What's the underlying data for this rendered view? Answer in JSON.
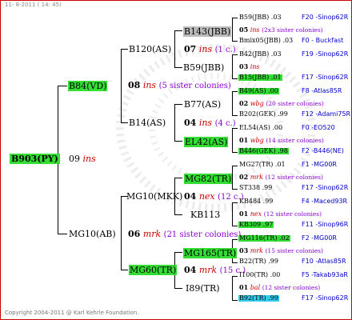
{
  "header": {
    "date": "11- 8-2011 ( 14: 45)"
  },
  "footer": {
    "copyright": "Copyright 2004-2011 @ Karl Kehrle Foundation."
  },
  "root": {
    "label": "B903(PY)",
    "year": "09",
    "mark": "ins"
  },
  "gen1": [
    {
      "label": "B84(VD)",
      "year": "08",
      "mark": "ins",
      "note": "(5 sister colonies)"
    },
    {
      "label": "MG10(AB)",
      "year": "06",
      "mark": "mrk",
      "note": "(21 sister colonies)"
    }
  ],
  "gen2": [
    {
      "label": "B120(AS)",
      "year": "07",
      "mark": "ins",
      "note": "(1 c.)"
    },
    {
      "label": "B14(AS)",
      "year": "04",
      "mark": "ins",
      "note": "(4 c.)"
    },
    {
      "label": "MG10(MKK)",
      "year": "04",
      "mark": "nex",
      "note": "(12 c.)"
    },
    {
      "label": "MG60(TR)",
      "year": "04",
      "mark": "mrk",
      "note": "(15 c.)"
    }
  ],
  "gen3": [
    {
      "label": "B143(JBB)"
    },
    {
      "label": "B59(JBB)"
    },
    {
      "label": "B77(AS)"
    },
    {
      "label": "EL42(AS)"
    },
    {
      "label": "MG82(TR)"
    },
    {
      "label": "KB113"
    },
    {
      "label": "MG165(TR)"
    },
    {
      "label": "I89(TR)"
    }
  ],
  "gen4": [
    {
      "father": "B59(JBB) .03",
      "fsrc": "F20 -Sinop62R",
      "year": "05",
      "mark": "ins",
      "note": "(2x3 sister colonies)",
      "mother": "Bmix05(JBB) .03",
      "msrc": "F0 - Buckfast"
    },
    {
      "father": "B42(JBB) .03",
      "fsrc": "F19 -Sinop62R",
      "year": "03",
      "mark": "ins",
      "note": "",
      "mother": "B15(JBB) .01",
      "msrc": "F17 -Sinop62R"
    },
    {
      "father": "B49(AS) .00",
      "fsrc": "F8 -Atlas85R",
      "year": "02",
      "mark": "wbg",
      "note": "(20 sister colonies)",
      "mother": "B202(GEK) .99",
      "msrc": "F12 -Adami75R"
    },
    {
      "father": "EL54(AS) .00",
      "fsrc": "F0 -EO520",
      "year": "01",
      "mark": "wbg",
      "note": "(14 sister colonies)",
      "mother": "B446(GEK) .98",
      "msrc": "F2 -B446(NE)"
    },
    {
      "father": "MG27(TR) .01",
      "fsrc": "F1 -MG00R",
      "year": "02",
      "mark": "mrk",
      "note": "(12 sister colonies)",
      "mother": "ST338 .99",
      "msrc": "F17 -Sinop62R"
    },
    {
      "father": "KB484 .99",
      "fsrc": "F4 -Maced93R",
      "year": "01",
      "mark": "nex",
      "note": "(12 sister colonies)",
      "mother": "KB309 .97",
      "msrc": "F11 -Sinop96R"
    },
    {
      "father": "MG116(TR) .02",
      "fsrc": "F2 -MG00R",
      "year": "03",
      "mark": "mrk",
      "note": "(15 sister colonies)",
      "mother": "B22(TR) .99",
      "msrc": "F10 -Atlas85R"
    },
    {
      "father": "I100(TR) .00",
      "fsrc": "F5 -Takab93aR",
      "year": "01",
      "mark": "bal",
      "note": "(12 sister colonies)",
      "mother": "B92(TR) .99",
      "msrc": "F17 -Sinop62R"
    }
  ]
}
